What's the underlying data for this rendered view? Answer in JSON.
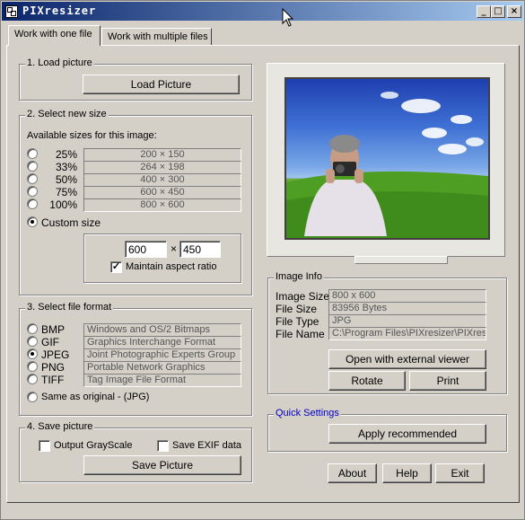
{
  "window": {
    "title": "PIXresizer",
    "controls": [
      "_",
      "□",
      "×"
    ]
  },
  "tabs": [
    {
      "label": "Work with one file",
      "active": true
    },
    {
      "label": "Work with multiple files",
      "active": false
    }
  ],
  "load": {
    "title": "1. Load picture",
    "button": "Load Picture"
  },
  "size": {
    "title": "2. Select new size",
    "subtitle": "Available sizes for this image:",
    "options": [
      {
        "label": "25%",
        "value": "200 × 150"
      },
      {
        "label": "33%",
        "value": "264 × 198"
      },
      {
        "label": "50%",
        "value": "400 × 300"
      },
      {
        "label": "75%",
        "value": "600 × 450"
      },
      {
        "label": "100%",
        "value": "800 × 600"
      }
    ],
    "custom_label": "Custom size",
    "custom_selected": true,
    "width": "600",
    "height": "450",
    "times": "×",
    "maintain_label": "Maintain aspect ratio",
    "maintain_checked": true
  },
  "format": {
    "title": "3. Select file format",
    "options": [
      {
        "label": "BMP",
        "desc": "Windows and OS/2 Bitmaps",
        "selected": false
      },
      {
        "label": "GIF",
        "desc": "Graphics Interchange Format",
        "selected": false
      },
      {
        "label": "JPEG",
        "desc": "Joint Photographic Experts Group",
        "selected": true
      },
      {
        "label": "PNG",
        "desc": "Portable Network Graphics",
        "selected": false
      },
      {
        "label": "TIFF",
        "desc": "Tag Image File Format",
        "selected": false
      }
    ],
    "same_label": "Same as original  - (JPG)"
  },
  "save": {
    "title": "4. Save picture",
    "grayscale_label": "Output GrayScale",
    "exif_label": "Save EXIF data",
    "button": "Save Picture"
  },
  "info": {
    "title": "Image Info",
    "rows": [
      {
        "label": "Image Size",
        "value": "800 x 600"
      },
      {
        "label": "File Size",
        "value": "83956 Bytes"
      },
      {
        "label": "File Type",
        "value": "JPG"
      },
      {
        "label": "File Name",
        "value": "C:\\Program Files\\PIXresizer\\PIXresiz"
      }
    ],
    "open_button": "Open with external viewer",
    "rotate_button": "Rotate",
    "print_button": "Print"
  },
  "quick": {
    "title": "Quick Settings",
    "button": "Apply recommended"
  },
  "footer": {
    "about": "About",
    "help": "Help",
    "exit": "Exit"
  },
  "colors": {
    "face": "#d4d0c8",
    "title_start": "#0a246a",
    "title_end": "#a6caf0",
    "quick_title": "#0000c8"
  }
}
